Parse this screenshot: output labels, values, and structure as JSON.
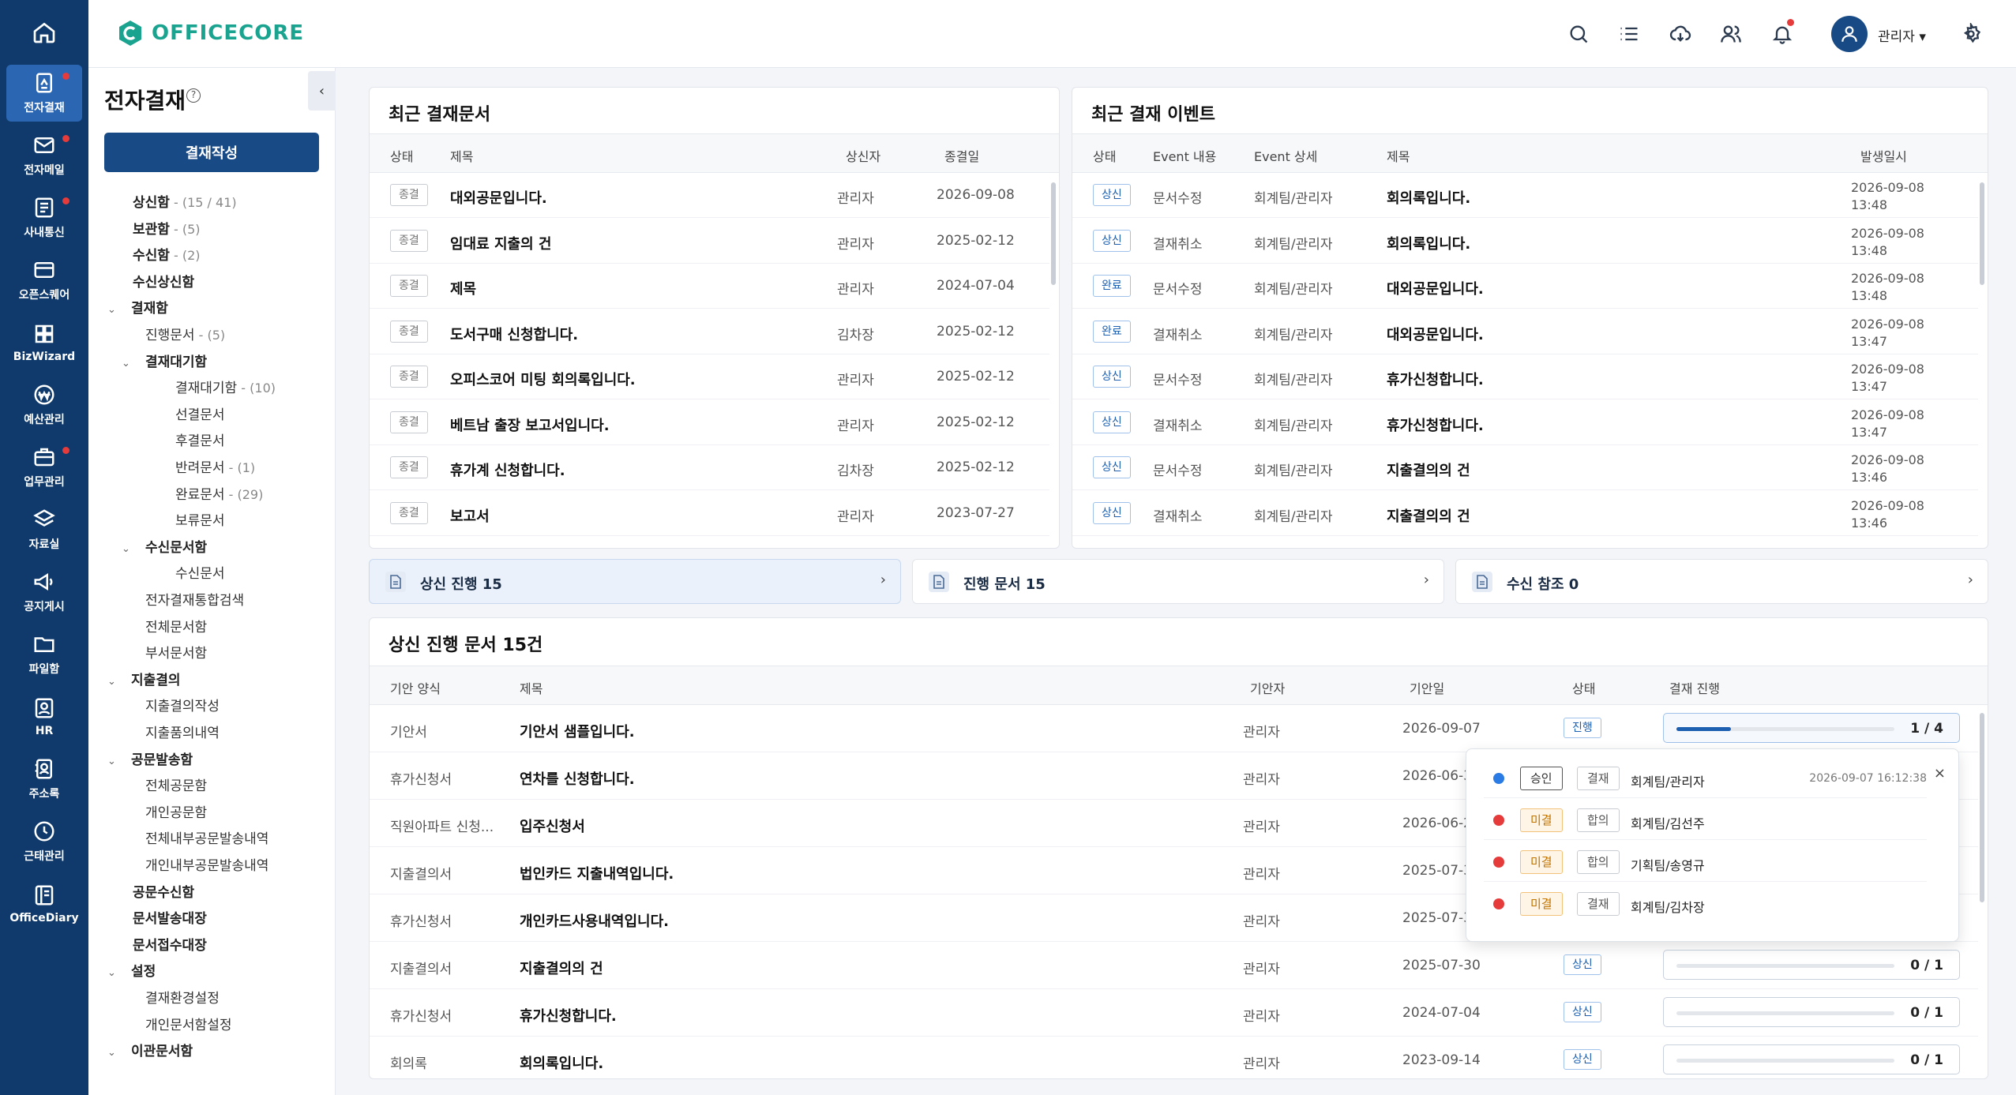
{
  "rail": {
    "items": [
      {
        "label": "전자결재",
        "icon": "approval-icon",
        "active": true,
        "dot": true
      },
      {
        "label": "전자메일",
        "icon": "mail-icon",
        "dot": true
      },
      {
        "label": "사내통신",
        "icon": "board-icon",
        "dot": true
      },
      {
        "label": "오픈스퀘어",
        "icon": "square-icon"
      },
      {
        "label": "BizWizard",
        "icon": "grid-icon"
      },
      {
        "label": "예산관리",
        "icon": "won-icon"
      },
      {
        "label": "업무관리",
        "icon": "briefcase-icon",
        "dot": true
      },
      {
        "label": "자료실",
        "icon": "layers-icon"
      },
      {
        "label": "공지게시",
        "icon": "megaphone-icon"
      },
      {
        "label": "파일함",
        "icon": "folder-icon"
      },
      {
        "label": "HR",
        "icon": "id-card-icon"
      },
      {
        "label": "주소록",
        "icon": "contacts-icon"
      },
      {
        "label": "근태관리",
        "icon": "clock-icon"
      },
      {
        "label": "OfficeDiary",
        "icon": "diary-icon"
      }
    ]
  },
  "header": {
    "brand": "OFFICECORE",
    "user": "관리자 ▾"
  },
  "lnb": {
    "title": "전자결재",
    "write_button": "결재작성",
    "collapse": "‹",
    "tree": [
      {
        "label": "상신함",
        "count": " - (15 / 41)",
        "bold": true,
        "level": 0
      },
      {
        "label": "보관함",
        "count": " - (5)",
        "bold": true,
        "level": 0
      },
      {
        "label": "수신함",
        "count": " - (2)",
        "bold": true,
        "level": 0
      },
      {
        "label": "수신상신함",
        "count": "",
        "bold": true,
        "level": 0
      },
      {
        "label": "결재함",
        "count": "",
        "bold": true,
        "level": 0,
        "chev": "⌄"
      },
      {
        "label": "진행문서",
        "count": " - (5)",
        "bold": false,
        "level": 1
      },
      {
        "label": "결재대기함",
        "count": "",
        "bold": true,
        "level": 1,
        "chev": "⌄"
      },
      {
        "label": "결재대기함",
        "count": " - (10)",
        "bold": false,
        "level": 2
      },
      {
        "label": "선결문서",
        "count": "",
        "bold": false,
        "level": 2
      },
      {
        "label": "후결문서",
        "count": "",
        "bold": false,
        "level": 2
      },
      {
        "label": "반려문서",
        "count": " - (1)",
        "bold": false,
        "level": 2
      },
      {
        "label": "완료문서",
        "count": " - (29)",
        "bold": false,
        "level": 2
      },
      {
        "label": "보류문서",
        "count": "",
        "bold": false,
        "level": 2
      },
      {
        "label": "수신문서함",
        "count": "",
        "bold": true,
        "level": 1,
        "chev": "⌄"
      },
      {
        "label": "수신문서",
        "count": "",
        "bold": false,
        "level": 2
      },
      {
        "label": "전자결재통합검색",
        "count": "",
        "bold": false,
        "level": 1
      },
      {
        "label": "전체문서함",
        "count": "",
        "bold": false,
        "level": 1
      },
      {
        "label": "부서문서함",
        "count": "",
        "bold": false,
        "level": 1
      },
      {
        "label": "지출결의",
        "count": "",
        "bold": true,
        "level": 0,
        "chev": "⌄"
      },
      {
        "label": "지출결의작성",
        "count": "",
        "bold": false,
        "level": 1
      },
      {
        "label": "지출품의내역",
        "count": "",
        "bold": false,
        "level": 1
      },
      {
        "label": "공문발송함",
        "count": "",
        "bold": true,
        "level": 0,
        "chev": "⌄"
      },
      {
        "label": "전체공문함",
        "count": "",
        "bold": false,
        "level": 1
      },
      {
        "label": "개인공문함",
        "count": "",
        "bold": false,
        "level": 1
      },
      {
        "label": "전체내부공문발송내역",
        "count": "",
        "bold": false,
        "level": 1
      },
      {
        "label": "개인내부공문발송내역",
        "count": "",
        "bold": false,
        "level": 1
      },
      {
        "label": "공문수신함",
        "count": "",
        "bold": true,
        "level": 0
      },
      {
        "label": "문서발송대장",
        "count": "",
        "bold": true,
        "level": 0
      },
      {
        "label": "문서접수대장",
        "count": "",
        "bold": true,
        "level": 0
      },
      {
        "label": "설정",
        "count": "",
        "bold": true,
        "level": 0,
        "chev": "⌄"
      },
      {
        "label": "결재환경설정",
        "count": "",
        "bold": false,
        "level": 1
      },
      {
        "label": "개인문서함설정",
        "count": "",
        "bold": false,
        "level": 1
      },
      {
        "label": "이관문서함",
        "count": "",
        "bold": true,
        "level": 0,
        "chev": "⌄"
      }
    ]
  },
  "recent_docs": {
    "title": "최근 결재문서",
    "columns": [
      "상태",
      "제목",
      "상신자",
      "종결일"
    ],
    "rows": [
      {
        "status": "종결",
        "title": "대외공문입니다.",
        "author": "관리자",
        "date": "2026-09-08"
      },
      {
        "status": "종결",
        "title": "임대료 지출의 건",
        "author": "관리자",
        "date": "2025-02-12"
      },
      {
        "status": "종결",
        "title": "제목",
        "author": "관리자",
        "date": "2024-07-04"
      },
      {
        "status": "종결",
        "title": "도서구매 신청합니다.",
        "author": "김차장",
        "date": "2025-02-12"
      },
      {
        "status": "종결",
        "title": "오피스코어 미팅 회의록입니다.",
        "author": "관리자",
        "date": "2025-02-12"
      },
      {
        "status": "종결",
        "title": "베트남 출장 보고서입니다.",
        "author": "관리자",
        "date": "2025-02-12"
      },
      {
        "status": "종결",
        "title": "휴가계 신청합니다.",
        "author": "김차장",
        "date": "2025-02-12"
      },
      {
        "status": "종결",
        "title": "보고서",
        "author": "관리자",
        "date": "2023-07-27"
      }
    ]
  },
  "recent_events": {
    "title": "최근 결재 이벤트",
    "columns": [
      "상태",
      "Event 내용",
      "Event 상세",
      "제목",
      "발생일시"
    ],
    "rows": [
      {
        "status": "상신",
        "event": "문서수정",
        "detail": "회계팀/관리자",
        "title": "회의록입니다.",
        "date": "2026-09-08",
        "time": "13:48"
      },
      {
        "status": "상신",
        "event": "결재취소",
        "detail": "회계팀/관리자",
        "title": "회의록입니다.",
        "date": "2026-09-08",
        "time": "13:48"
      },
      {
        "status": "완료",
        "event": "문서수정",
        "detail": "회계팀/관리자",
        "title": "대외공문입니다.",
        "date": "2026-09-08",
        "time": "13:48"
      },
      {
        "status": "완료",
        "event": "결재취소",
        "detail": "회계팀/관리자",
        "title": "대외공문입니다.",
        "date": "2026-09-08",
        "time": "13:47"
      },
      {
        "status": "상신",
        "event": "문서수정",
        "detail": "회계팀/관리자",
        "title": "휴가신청합니다.",
        "date": "2026-09-08",
        "time": "13:47"
      },
      {
        "status": "상신",
        "event": "결재취소",
        "detail": "회계팀/관리자",
        "title": "휴가신청합니다.",
        "date": "2026-09-08",
        "time": "13:47"
      },
      {
        "status": "상신",
        "event": "문서수정",
        "detail": "회계팀/관리자",
        "title": "지출결의의 건",
        "date": "2026-09-08",
        "time": "13:46"
      },
      {
        "status": "상신",
        "event": "결재취소",
        "detail": "회계팀/관리자",
        "title": "지출결의의 건",
        "date": "2026-09-08",
        "time": "13:46"
      }
    ]
  },
  "summary": [
    {
      "label": "상신 진행 15",
      "active": true
    },
    {
      "label": "진행 문서 15",
      "active": false
    },
    {
      "label": "수신 참조 0",
      "active": false
    }
  ],
  "progress_docs": {
    "title": "상신 진행 문서 15건",
    "columns": [
      "기안 양식",
      "제목",
      "기안자",
      "기안일",
      "상태",
      "결재 진행"
    ],
    "rows": [
      {
        "form": "기안서",
        "title": "기안서 샘플입니다.",
        "author": "관리자",
        "date": "2026-09-07",
        "status": "진행",
        "progress": "1 / 4",
        "fraction": 0.25,
        "active": true
      },
      {
        "form": "휴가신청서",
        "title": "연차를 신청합니다.",
        "author": "관리자",
        "date": "2026-06-3",
        "status": "",
        "progress": "",
        "fraction": 0
      },
      {
        "form": "직원아파트 신청...",
        "title": "입주신청서",
        "author": "관리자",
        "date": "2026-06-2",
        "status": "",
        "progress": "",
        "fraction": 0
      },
      {
        "form": "지출결의서",
        "title": "법인카드 지출내역입니다.",
        "author": "관리자",
        "date": "2025-07-3",
        "status": "",
        "progress": "",
        "fraction": 0
      },
      {
        "form": "휴가신청서",
        "title": "개인카드사용내역입니다.",
        "author": "관리자",
        "date": "2025-07-3",
        "status": "",
        "progress": "",
        "fraction": 0
      },
      {
        "form": "지출결의서",
        "title": "지출결의의 건",
        "author": "관리자",
        "date": "2025-07-30",
        "status": "상신",
        "progress": "0 / 1",
        "fraction": 0
      },
      {
        "form": "휴가신청서",
        "title": "휴가신청합니다.",
        "author": "관리자",
        "date": "2024-07-04",
        "status": "상신",
        "progress": "0 / 1",
        "fraction": 0
      },
      {
        "form": "회의록",
        "title": "회의록입니다.",
        "author": "관리자",
        "date": "2023-09-14",
        "status": "상신",
        "progress": "0 / 1",
        "fraction": 0
      }
    ]
  },
  "popup": {
    "close": "×",
    "rows": [
      {
        "dot": "#2b7be4",
        "state": "승인",
        "state_type": "ok",
        "kind": "결재",
        "name": "회계팀/관리자",
        "date": "2026-09-07 16:12:38"
      },
      {
        "dot": "#e53b3b",
        "state": "미결",
        "state_type": "pend",
        "kind": "합의",
        "name": "회계팀/김선주",
        "date": ""
      },
      {
        "dot": "#e53b3b",
        "state": "미결",
        "state_type": "pend",
        "kind": "합의",
        "name": "기획팀/송영규",
        "date": ""
      },
      {
        "dot": "#e53b3b",
        "state": "미결",
        "state_type": "pend",
        "kind": "결재",
        "name": "회계팀/김차장",
        "date": ""
      }
    ]
  }
}
